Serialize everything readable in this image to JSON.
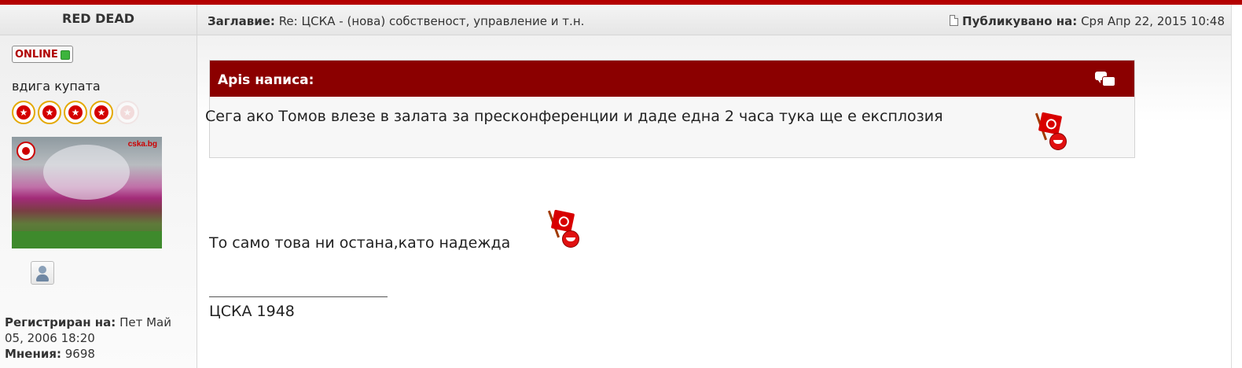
{
  "author": {
    "name": "RED DEAD",
    "status_label": "ONLINE",
    "rank": "вдига купата",
    "stars_filled": 4,
    "stars_total": 5
  },
  "profile": {
    "registered_label": "Регистриран на:",
    "registered_value": "Пет Май 05, 2006 18:20",
    "posts_label": "Мнения:",
    "posts_value": "9698",
    "avatar_tag": "cska.bg"
  },
  "post": {
    "subject_label": "Заглавие:",
    "subject_value": "Re: ЦСКА - (нова) собственост, управление и т.н.",
    "posted_label": "Публикувано на:",
    "posted_value": "Сря Апр 22, 2015 10:48"
  },
  "quote": {
    "header": "Apis написа:",
    "text": "Сега ако Томов влезе в залата за пресконференции и даде една 2 часа тука ще е експлозия"
  },
  "message": {
    "text": "То само това ни остана,като надежда",
    "signature": "ЦСКА 1948"
  },
  "colors": {
    "accent": "#8b0000",
    "top_rule": "#b40000",
    "online": "#3cb43c"
  }
}
